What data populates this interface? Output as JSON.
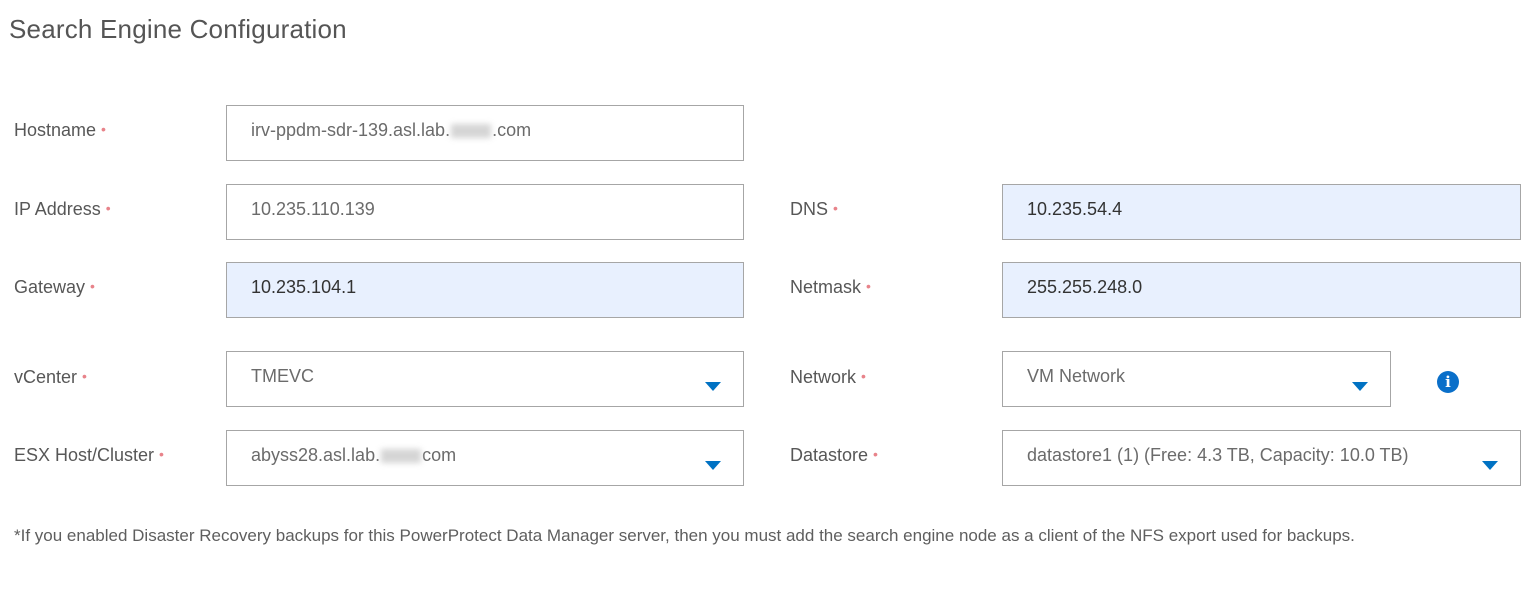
{
  "title": "Search Engine Configuration",
  "required_marker": "•",
  "fields": {
    "hostname": {
      "label": "Hostname",
      "value_prefix": "irv-ppdm-sdr-139.asl.lab.",
      "value_suffix": ".com",
      "redacted": true
    },
    "ip_address": {
      "label": "IP Address",
      "value": "10.235.110.139"
    },
    "dns": {
      "label": "DNS",
      "value": "10.235.54.4"
    },
    "gateway": {
      "label": "Gateway",
      "value": "10.235.104.1"
    },
    "netmask": {
      "label": "Netmask",
      "value": "255.255.248.0"
    },
    "vcenter": {
      "label": "vCenter",
      "value": "TMEVC"
    },
    "network": {
      "label": "Network",
      "value": "VM Network"
    },
    "esx_host": {
      "label": "ESX Host/Cluster",
      "value_prefix": "abyss28.asl.lab.",
      "value_suffix": "com",
      "redacted": true
    },
    "datastore": {
      "label": "Datastore",
      "value": "datastore1 (1) (Free: 4.3 TB, Capacity: 10.0 TB)"
    }
  },
  "icons": {
    "network_info": "info-icon",
    "dropdown": "caret-down-icon"
  },
  "note": "*If you enabled Disaster Recovery backups for this PowerProtect Data Manager server, then you must add the search engine node as a client of the NFS export used for backups.",
  "colors": {
    "accent": "#0072c3",
    "autofill_bg": "#e8f0fe",
    "required": "#e8838a"
  }
}
